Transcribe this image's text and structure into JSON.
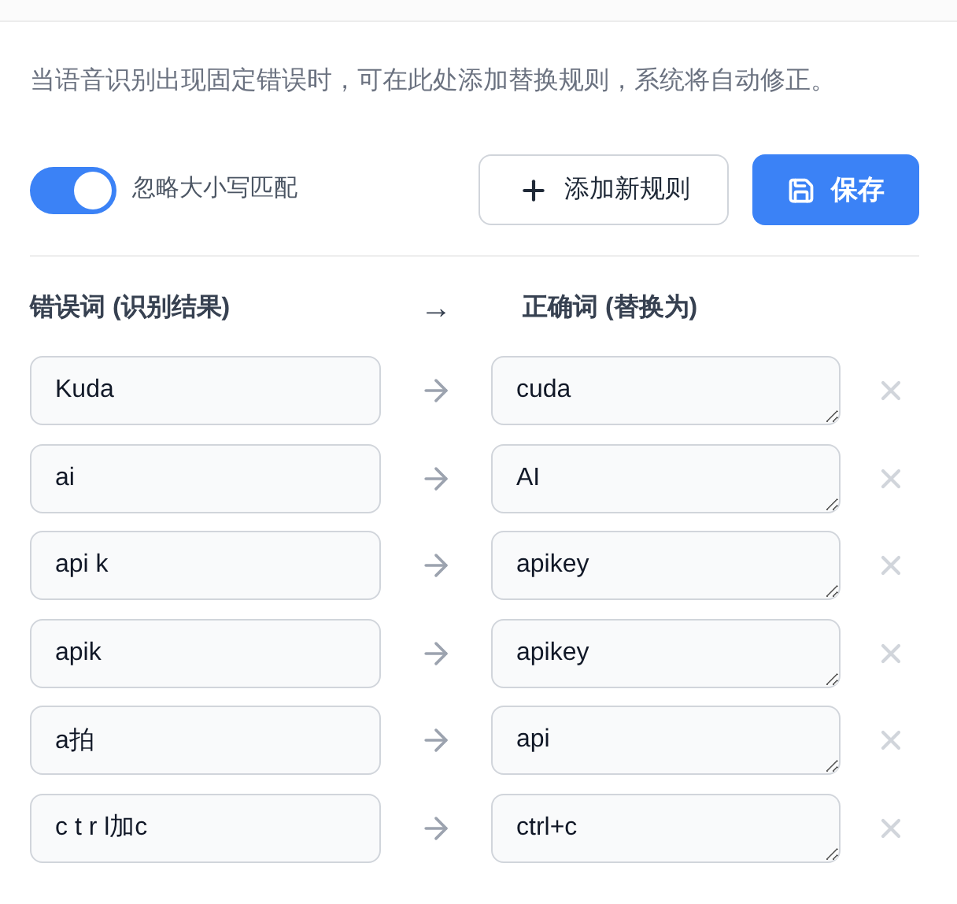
{
  "description": "当语音识别出现固定错误时，可在此处添加替换规则，系统将自动修正。",
  "ignore_case": {
    "label": "忽略大小写匹配",
    "on": true
  },
  "buttons": {
    "add": "添加新规则",
    "save": "保存"
  },
  "header": {
    "wrong": "错误词 (识别结果)",
    "arrow": "→",
    "right": "正确词 (替换为)"
  },
  "rules": [
    {
      "wrong": "Kuda",
      "right": "cuda"
    },
    {
      "wrong": "ai",
      "right": "AI"
    },
    {
      "wrong": "api k",
      "right": "apikey"
    },
    {
      "wrong": "apik",
      "right": "apikey"
    },
    {
      "wrong": "a拍",
      "right": "api"
    },
    {
      "wrong": "c t r l加c",
      "right": "ctrl+c"
    }
  ]
}
